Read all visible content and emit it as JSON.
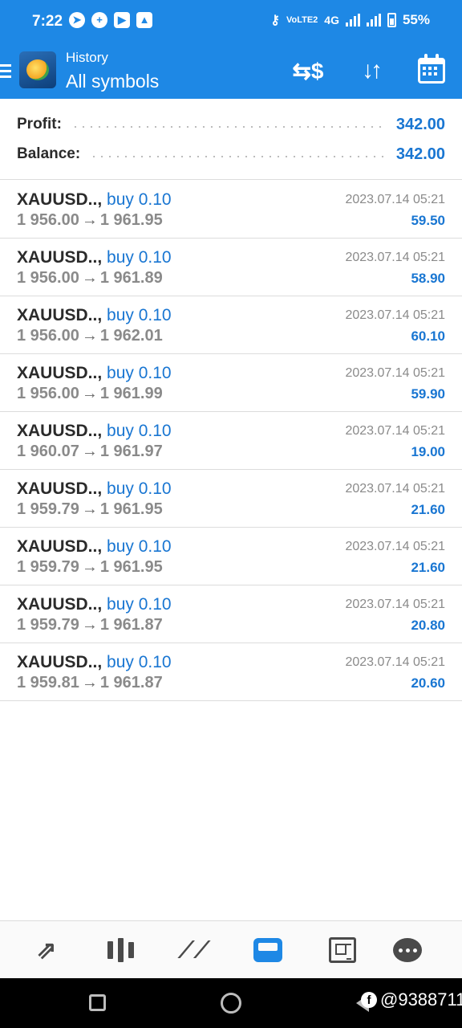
{
  "status_bar": {
    "time": "7:22",
    "network": "4G",
    "volte": "VoLTE2",
    "battery": "55%"
  },
  "header": {
    "subtitle": "History",
    "title": "All symbols",
    "actions": [
      "currency-exchange-icon",
      "sort-icon",
      "calendar-icon"
    ]
  },
  "summary": {
    "profit_label": "Profit:",
    "profit_value": "342.00",
    "balance_label": "Balance:",
    "balance_value": "342.00"
  },
  "deals": [
    {
      "symbol": "XAUUSD..,",
      "side": "buy 0.10",
      "open": "1 956.00",
      "close": "1 961.95",
      "time": "2023.07.14 05:21",
      "profit": "59.50"
    },
    {
      "symbol": "XAUUSD..,",
      "side": "buy 0.10",
      "open": "1 956.00",
      "close": "1 961.89",
      "time": "2023.07.14 05:21",
      "profit": "58.90"
    },
    {
      "symbol": "XAUUSD..,",
      "side": "buy 0.10",
      "open": "1 956.00",
      "close": "1 962.01",
      "time": "2023.07.14 05:21",
      "profit": "60.10"
    },
    {
      "symbol": "XAUUSD..,",
      "side": "buy 0.10",
      "open": "1 956.00",
      "close": "1 961.99",
      "time": "2023.07.14 05:21",
      "profit": "59.90"
    },
    {
      "symbol": "XAUUSD..,",
      "side": "buy 0.10",
      "open": "1 960.07",
      "close": "1 961.97",
      "time": "2023.07.14 05:21",
      "profit": "19.00"
    },
    {
      "symbol": "XAUUSD..,",
      "side": "buy 0.10",
      "open": "1 959.79",
      "close": "1 961.95",
      "time": "2023.07.14 05:21",
      "profit": "21.60"
    },
    {
      "symbol": "XAUUSD..,",
      "side": "buy 0.10",
      "open": "1 959.79",
      "close": "1 961.95",
      "time": "2023.07.14 05:21",
      "profit": "21.60"
    },
    {
      "symbol": "XAUUSD..,",
      "side": "buy 0.10",
      "open": "1 959.79",
      "close": "1 961.87",
      "time": "2023.07.14 05:21",
      "profit": "20.80"
    },
    {
      "symbol": "XAUUSD..,",
      "side": "buy 0.10",
      "open": "1 959.81",
      "close": "1 961.87",
      "time": "2023.07.14 05:21",
      "profit": "20.60"
    }
  ],
  "arrow": "→",
  "bottom_nav": [
    "quotes-icon",
    "chart-icon",
    "trade-icon",
    "history-icon",
    "news-icon",
    "chat-icon"
  ],
  "bottom_nav_active": "history-icon",
  "watermark": "@9388711",
  "colors": {
    "accent": "#1e88e5",
    "value_blue": "#1976d2",
    "muted": "#8a8a8a"
  }
}
